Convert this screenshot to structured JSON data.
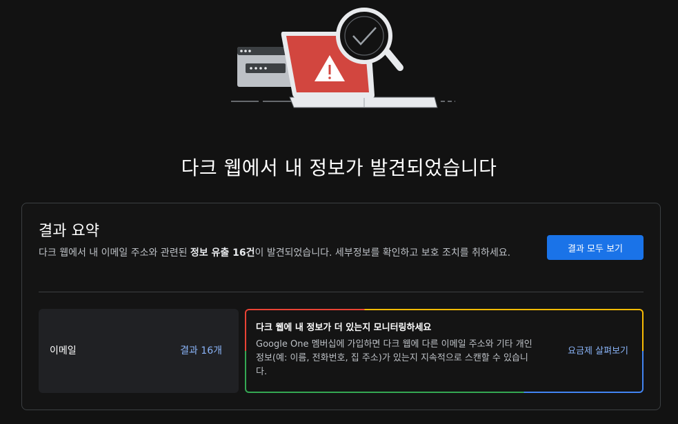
{
  "page": {
    "headline": "다크 웹에서 내 정보가 발견되었습니다"
  },
  "summary": {
    "title": "결과 요약",
    "desc_prefix": "다크 웹에서 내 이메일 주소와 관련된 ",
    "desc_bold": "정보 유출 16건",
    "desc_suffix": "이 발견되었습니다. 세부정보를 확인하고 보호 조치를 취하세요.",
    "view_all_button": "결과 모두 보기"
  },
  "email_tile": {
    "label": "이메일",
    "count_link": "결과 16개"
  },
  "monitor_tile": {
    "title": "다크 웹에 내 정보가 더 있는지 모니터링하세요",
    "desc": "Google One 멤버십에 가입하면 다크 웹에 다른 이메일 주소와 기타 개인 정보(예: 이름, 전화번호, 집 주소)가 있는지 지속적으로 스캔할 수 있습니다.",
    "plans_link": "요금제 살펴보기",
    "border_colors": [
      "#ea4335",
      "#fbbc04",
      "#34a853",
      "#4285f4"
    ]
  },
  "icons": {
    "hero": "dark-web-warning-illustration"
  },
  "colors": {
    "accent": "#1a73e8",
    "link": "#8ab4f8",
    "warning_red": "#d2463f"
  }
}
